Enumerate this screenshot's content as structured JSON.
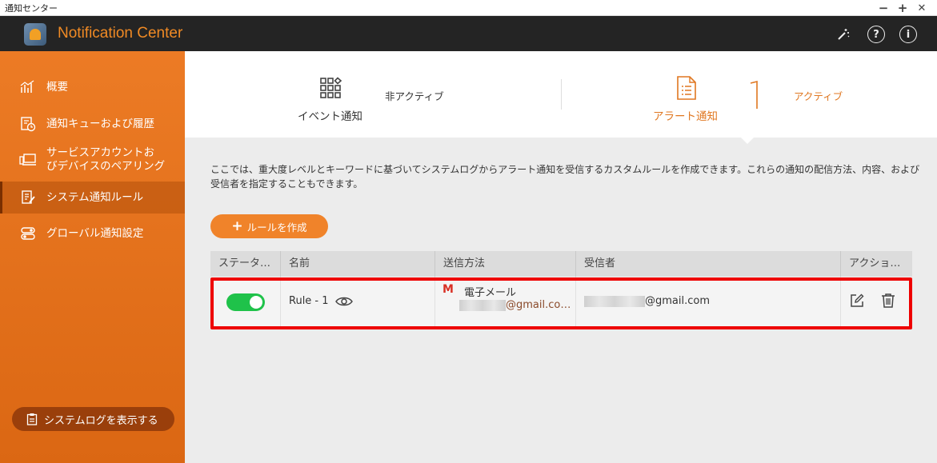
{
  "window": {
    "title": "通知センター",
    "minimize": "−",
    "maximize": "+",
    "close": "✕"
  },
  "app": {
    "title": "Notification Center",
    "info_glyph": "i",
    "help_glyph": "?"
  },
  "sidebar": {
    "items": [
      {
        "label": "概要",
        "icon": "chart-icon"
      },
      {
        "label": "通知キューおよび履歴",
        "icon": "history-icon"
      },
      {
        "label_line1": "サービスアカウントお",
        "label_line2": "びデバイスのペアリング",
        "icon": "device-pairing-icon"
      },
      {
        "label": "システム通知ルール",
        "icon": "rules-icon",
        "active": true
      },
      {
        "label": "グローバル通知設定",
        "icon": "toggles-icon"
      }
    ],
    "log_button": "システムログを表示する"
  },
  "tabs": {
    "event": {
      "label": "イベント通知",
      "status": "非アクティブ"
    },
    "alert": {
      "label": "アラート通知",
      "status": "アクティブ",
      "selected": true
    }
  },
  "description": "ここでは、重大度レベルとキーワードに基づいてシステムログからアラート通知を受信するカスタムルールを作成できます。これらの通知の配信方法、内容、および受信者を指定することもできます。",
  "create_button": "ルールを作成",
  "table": {
    "headers": [
      "ステータ…",
      "名前",
      "送信方法",
      "受信者",
      "アクショ…"
    ],
    "rows": [
      {
        "enabled": true,
        "name": "Rule - 1",
        "method_icon": "M",
        "method": "電子メール",
        "method_email": "@gmail.co…",
        "recipient": "@gmail.com"
      }
    ]
  },
  "colors": {
    "accent": "#f0832a",
    "sidebar": "#e5721c",
    "toggle_on": "#1fc24a",
    "highlight": "#ee0000",
    "gmail": "#d93025"
  }
}
